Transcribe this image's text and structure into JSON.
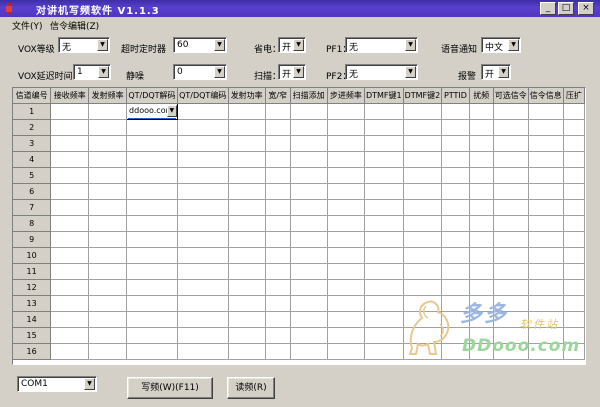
{
  "title": "对讲机写频软件  V1.1.3",
  "window_buttons": {
    "minimize": "_",
    "maximize": "□",
    "close": "×"
  },
  "menu": [
    {
      "label": "文件(Y)"
    },
    {
      "label": "信令编辑(Z)"
    }
  ],
  "settings": {
    "vox_level": {
      "label": "VOX等级",
      "value": "无"
    },
    "timeout": {
      "label": "超时定时器",
      "value": "60"
    },
    "power_save": {
      "label": "省电：",
      "value": "开"
    },
    "pf1": {
      "label": "PF1：",
      "value": "无"
    },
    "voice_notice": {
      "label": "语音通知",
      "value": "中文"
    },
    "vox_delay": {
      "label": "VOX延迟时间",
      "value": "1"
    },
    "squelch": {
      "label": "静噪",
      "value": "0"
    },
    "scan": {
      "label": "扫描：",
      "value": "开"
    },
    "pf2": {
      "label": "PF2：",
      "value": "无"
    },
    "alarm": {
      "label": "报警",
      "value": "开"
    }
  },
  "table": {
    "columns": [
      "信道编号",
      "接收频率",
      "发射频率",
      "QT/DQT解码",
      "QT/DQT编码",
      "发射功率",
      "宽/窄",
      "扫描添加",
      "步进频率",
      "DTMF键1",
      "DTMF键2",
      "PTTID",
      "扰频",
      "可选信令",
      "信令信息",
      "压扩"
    ],
    "row_numbers": [
      "1",
      "2",
      "3",
      "4",
      "5",
      "6",
      "7",
      "8",
      "9",
      "10",
      "11",
      "12",
      "13",
      "14",
      "15",
      "16"
    ],
    "active_cell_value": "ddooo.com"
  },
  "watermark": {
    "line1": "多多",
    "line2": "软件站",
    "line3": "DDooo.com"
  },
  "footer": {
    "com_port": "COM1",
    "write_button": "写频(W)(F11)",
    "read_button": "读频(R)"
  },
  "colors": {
    "titlebar": "#4f35c0",
    "face": "#d4d0c8",
    "focus": "#2a5fd0"
  },
  "icons": {
    "dropdown": "chevron-down-icon",
    "app": "app-icon"
  }
}
